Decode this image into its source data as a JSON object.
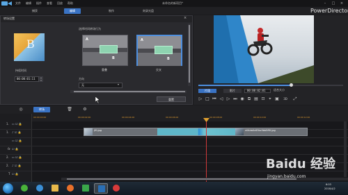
{
  "app": {
    "window_title": "未命名的新项目*",
    "brand": "PowerDirector",
    "menu": [
      "文件",
      "编辑",
      "插件",
      "查看",
      "回放",
      "帮助"
    ]
  },
  "tabs": [
    {
      "label": "捕获",
      "active": false
    },
    {
      "label": "编辑",
      "active": true
    },
    {
      "label": "制作",
      "active": false
    },
    {
      "label": "刻录光盘",
      "active": false
    }
  ],
  "transition_panel": {
    "title": "转场设置",
    "thumb_letter": "B",
    "duration_label": "持续时间",
    "duration_value": "00:00:01:11",
    "behavior_label": "选择时间转场行为",
    "options": [
      {
        "a": "A",
        "b": "B",
        "caption": "重叠",
        "selected": false
      },
      {
        "a": "A",
        "b": "B",
        "caption": "交叉",
        "selected": true
      }
    ],
    "direction_label": "方向",
    "direction_value": "无",
    "reset_button": "重置"
  },
  "preview": {
    "tabs": [
      {
        "label": "片段",
        "active": true
      },
      {
        "label": "影片",
        "active": false
      }
    ],
    "timecode": "00:00:02:01",
    "fit_label": "适合大小",
    "progress": 0.64,
    "controls": [
      "▷",
      "□",
      "⏮",
      "◁",
      "▷",
      "⏭",
      "◉",
      "⧉",
      "▤",
      "⊡",
      "⌖",
      "▣",
      "3D",
      "⤢"
    ]
  },
  "timeline": {
    "fx_button": "转场",
    "ruler": [
      "00:00:00:00",
      "00:00:02:00",
      "00:00:04:00",
      "00:00:06:00",
      "00:00:08:00",
      "00:00:10:00",
      "00:00:12:00"
    ],
    "tracks": [
      {
        "left": "",
        "num": "1.",
        "icons": "▭ ☑ 🔒"
      },
      {
        "left": "",
        "num": "1.",
        "icons": "♪ ☑ 🔒"
      },
      {
        "left": "",
        "num": "",
        "icons": "▭ ☑ 🔒"
      },
      {
        "left": "fx",
        "num": "",
        "icons": "☑ 🔒"
      },
      {
        "left": "",
        "num": "2.",
        "icons": "▭ ☑ 🔒"
      },
      {
        "left": "",
        "num": "2.",
        "icons": "♪ ☑ 🔒"
      },
      {
        "left": "T",
        "num": "",
        "icons": "☑ 🔒"
      },
      {
        "left": "",
        "num": "",
        "icons": "🎤 ☑ 🔒"
      }
    ],
    "clip1_name": "jf0.jpg",
    "clip2_name": "v04da0c63bc5bb5ff0.jpg"
  },
  "taskbar": {
    "time": "6:03",
    "date": "2016/4/2"
  },
  "watermark": {
    "text": "Baidu 经验",
    "url": "jingyan.baidu.com"
  },
  "colors": {
    "accent": "#3a73c4",
    "selection": "#4d8fe0",
    "playhead": "#d23a3a",
    "ruler_text": "#e09a2e"
  }
}
